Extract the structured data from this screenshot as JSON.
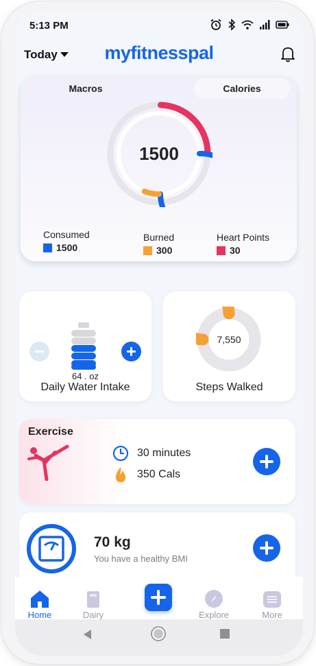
{
  "status_bar": {
    "time": "5:13 PM",
    "icons": [
      "alarm-icon",
      "bluetooth-icon",
      "wifi-icon",
      "signal-icon",
      "battery-icon"
    ]
  },
  "header": {
    "date_selector": "Today",
    "brand": "myfitnesspal"
  },
  "colors": {
    "brand_blue": "#1565e8",
    "burned_orange": "#f7a033",
    "heart_red": "#e6335f",
    "track_gray": "#e5e5ea"
  },
  "summary": {
    "tabs": [
      {
        "label": "Macros",
        "active": false
      },
      {
        "label": "Calories",
        "active": true
      }
    ],
    "total": "1500",
    "legend": [
      {
        "label": "Consumed",
        "value": "1500",
        "color": "#1565e8"
      },
      {
        "label": "Burned",
        "value": "300",
        "color": "#f7a033"
      },
      {
        "label": "Heart Points",
        "value": "30",
        "color": "#e6335f"
      }
    ]
  },
  "water": {
    "amount": "64 . oz",
    "title": "Daily Water Intake"
  },
  "steps": {
    "count": "7,550",
    "title": "Steps Walked",
    "progress": 0.75
  },
  "exercise": {
    "title": "Exercise",
    "duration": "30 minutes",
    "calories": "350 Cals"
  },
  "weight": {
    "value": "70 kg",
    "message": "You have a healthy BMI"
  },
  "bottom_nav": [
    {
      "label": "Home",
      "icon": "home-icon",
      "active": true
    },
    {
      "label": "Dairy",
      "icon": "book-icon",
      "active": false
    },
    {
      "label": "Explore",
      "icon": "compass-icon",
      "active": false
    },
    {
      "label": "More",
      "icon": "menu-icon",
      "active": false
    }
  ]
}
